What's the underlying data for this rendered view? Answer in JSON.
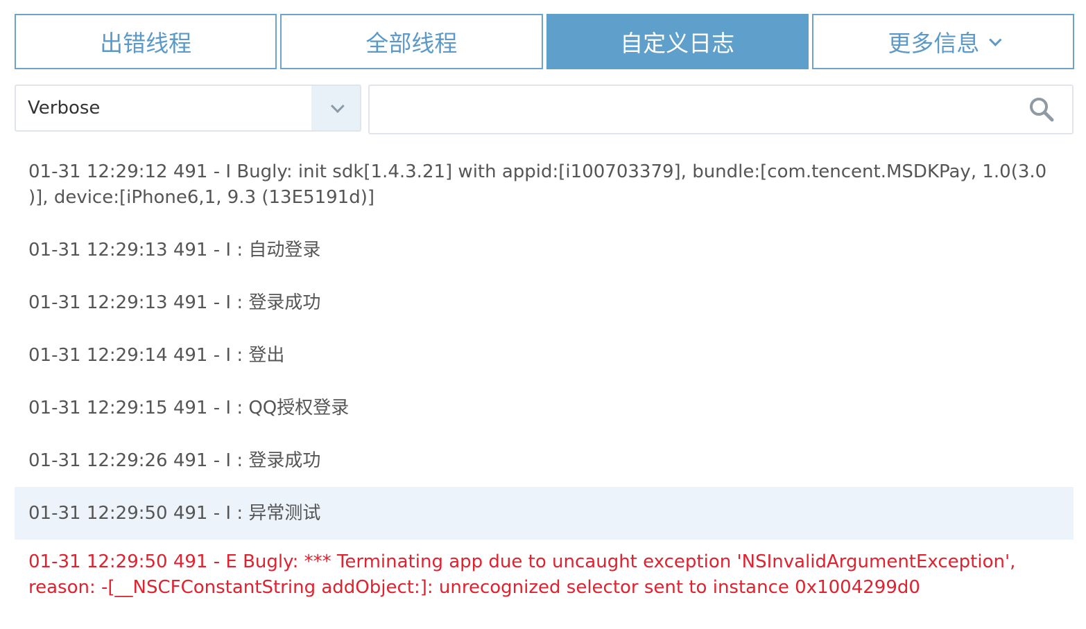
{
  "tabs": [
    {
      "label": "出错线程",
      "active": false
    },
    {
      "label": "全部线程",
      "active": false
    },
    {
      "label": "自定义日志",
      "active": true
    },
    {
      "label": "更多信息",
      "active": false,
      "has_dropdown": true
    }
  ],
  "filter": {
    "level": "Verbose"
  },
  "search": {
    "placeholder": "",
    "value": ""
  },
  "logs": [
    {
      "text": "01-31 12:29:12 491 - I Bugly: init sdk[1.4.3.21] with appid:[i100703379], bundle:[com.tencent.MSDKPay, 1.0(3.0)], device:[iPhone6,1, 9.3 (13E5191d)]",
      "line1": "01-31 12:29:12 491 - I Bugly: init sdk[1.4.3.21] with appid:[i100703379], bundle:[com.tencent.MSDKPay, 1.0(3.0",
      "line2": ")], device:[iPhone6,1, 9.3 (13E5191d)]",
      "level": "I"
    },
    {
      "text": "01-31 12:29:13 491 - I : 自动登录",
      "level": "I"
    },
    {
      "text": "01-31 12:29:13 491 - I : 登录成功",
      "level": "I"
    },
    {
      "text": "01-31 12:29:14 491 - I : 登出",
      "level": "I"
    },
    {
      "text": "01-31 12:29:15 491 - I : QQ授权登录",
      "level": "I"
    },
    {
      "text": "01-31 12:29:26 491 - I : 登录成功",
      "level": "I"
    },
    {
      "text": "01-31 12:29:50 491 - I : 异常测试",
      "level": "I",
      "highlighted": true
    },
    {
      "line1": "01-31 12:29:50 491 - E Bugly: *** Terminating app due to uncaught exception 'NSInvalidArgumentException',",
      "line2": "reason: -[__NSCFConstantString addObject:]: unrecognized selector sent to instance 0x1004299d0",
      "level": "E"
    }
  ],
  "colors": {
    "accent": "#5f9fcb",
    "error": "#e0212e",
    "highlight_row": "#edf3fa"
  },
  "icons": {
    "tab_dropdown": "chevron-down-icon",
    "level_dropdown": "chevron-down-icon",
    "search": "search-icon"
  }
}
